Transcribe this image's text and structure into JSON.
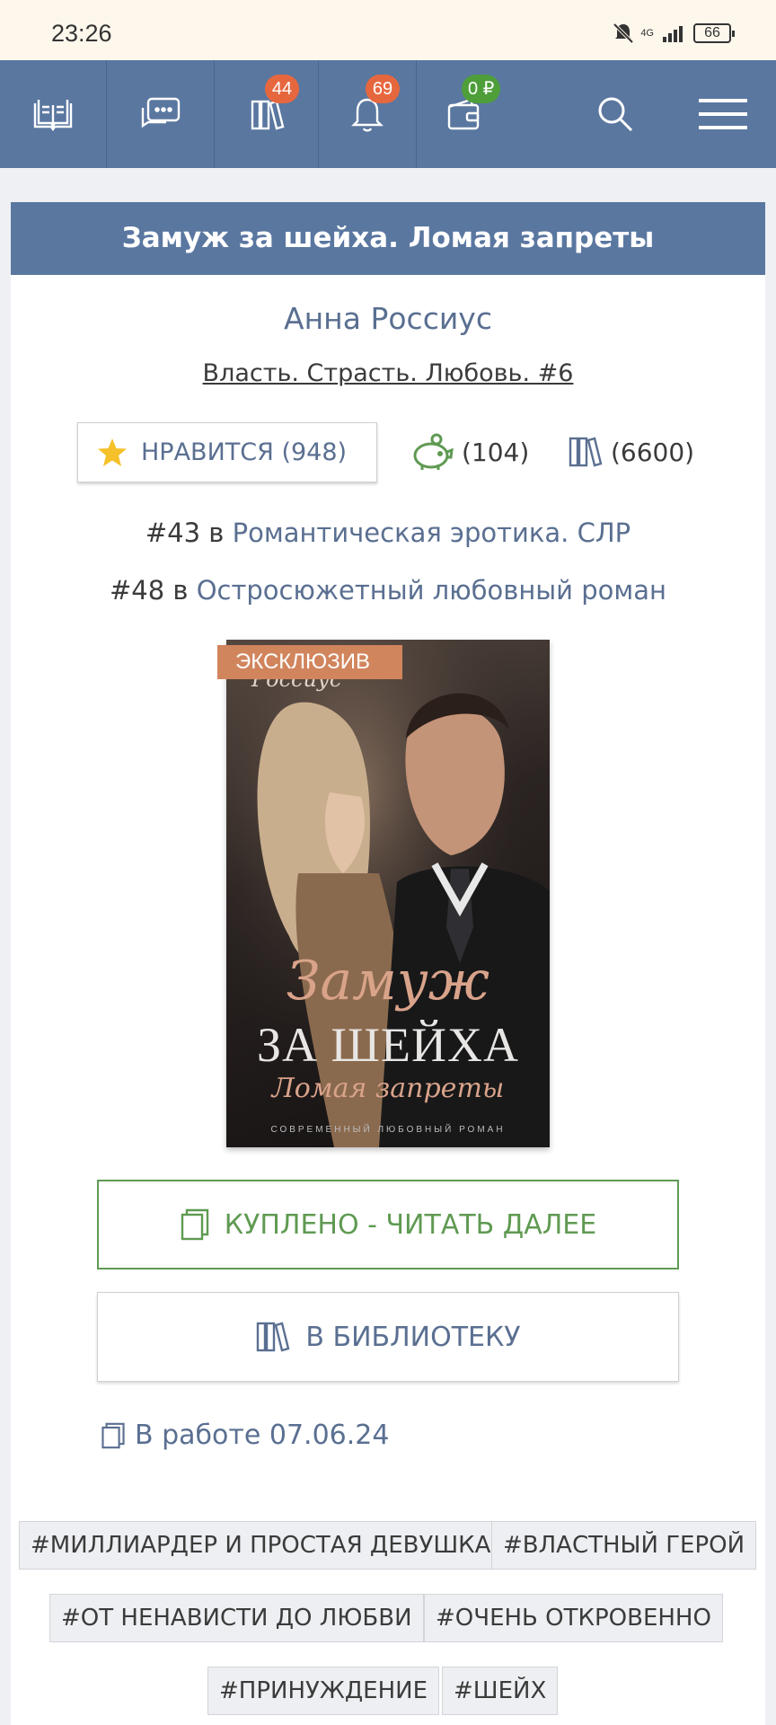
{
  "status_bar": {
    "time": "23:26",
    "network": "4G",
    "battery": "66"
  },
  "nav": {
    "badges": {
      "library": "44",
      "notifications": "69",
      "wallet": "0 ₽"
    }
  },
  "book": {
    "title": "Замуж за шейха. Ломая запреты",
    "author": "Анна Россиус",
    "series": "Власть. Страсть. Любовь. #6",
    "like_label": "НРАВИТСЯ (948)",
    "rewards_count": "(104)",
    "library_count": "(6600)",
    "ranks": [
      {
        "position": "#43",
        "in": "в",
        "category": "Романтическая эротика. СЛР"
      },
      {
        "position": "#48",
        "in": "в",
        "category": "Остросюжетный любовный роман"
      }
    ],
    "cover": {
      "badge": "ЭКСКЛЮЗИВ",
      "author_script": "Россиус",
      "title_line1": "Замуж",
      "title_line2": "ЗА ШЕЙХА",
      "title_line3": "Ломая запреты",
      "genre": "СОВРЕМЕННЫЙ ЛЮБОВНЫЙ РОМАН"
    },
    "read_button": "КУПЛЕНО - ЧИТАТЬ ДАЛЕЕ",
    "library_button": "В БИБЛИОТЕКУ",
    "status_text": "В работе 07.06.24",
    "tags": [
      "#МИЛЛИАРДЕР И ПРОСТАЯ ДЕВУШКА",
      "#ВЛАСТНЫЙ ГЕРОЙ",
      "#ОТ НЕНАВИСТИ ДО ЛЮБВИ",
      "#ОЧЕНЬ ОТКРОВЕННО",
      "#ПРИНУЖДЕНИЕ",
      "#ШЕЙХ"
    ]
  },
  "colors": {
    "nav": "#5a77a0",
    "accent_green": "#5f9a52",
    "badge_orange": "#e6673e",
    "badge_green": "#4e9e3a",
    "link": "#5a6f91"
  },
  "icons": [
    "book-open-icon",
    "chat-icon",
    "library-icon",
    "bell-icon",
    "wallet-icon",
    "search-icon",
    "menu-icon",
    "star-icon",
    "piggy-bank-icon",
    "books-icon",
    "book-icon"
  ]
}
